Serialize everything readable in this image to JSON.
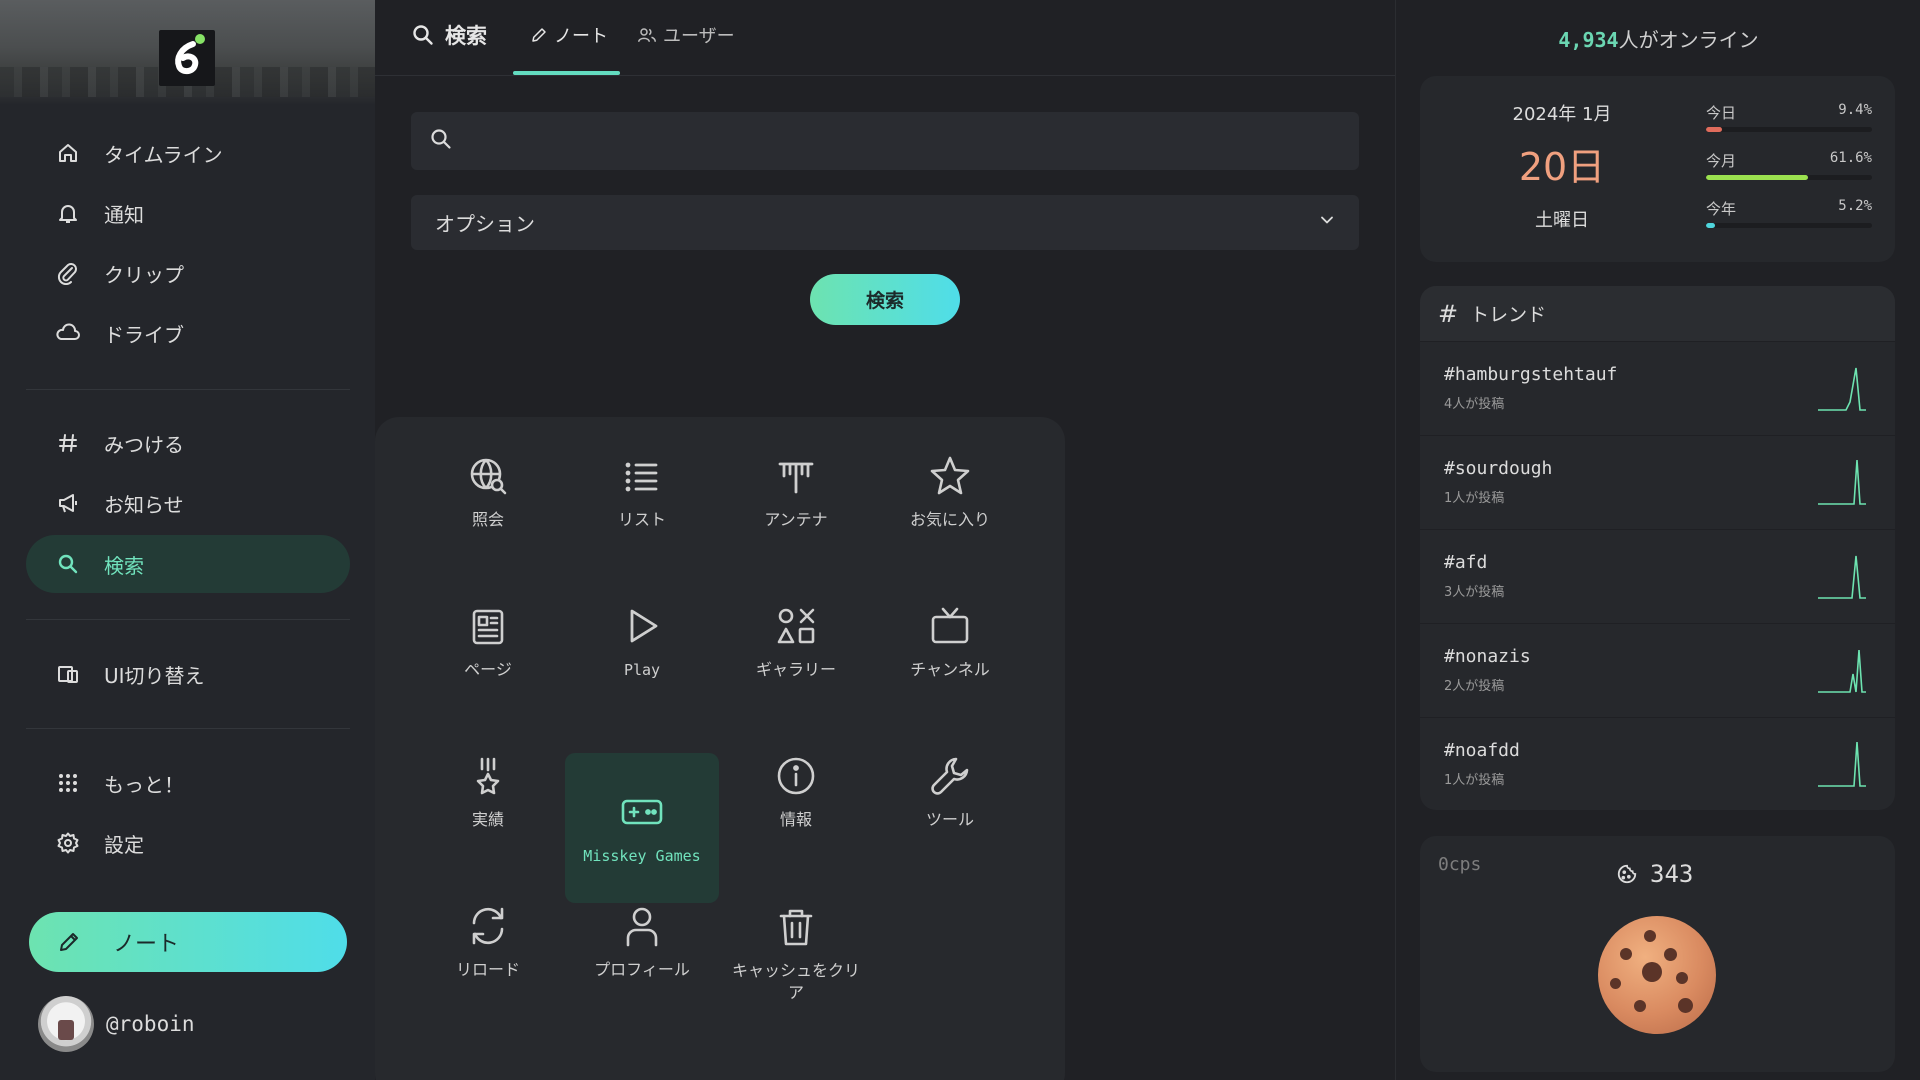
{
  "sidebar": {
    "items": [
      {
        "label": "タイムライン",
        "icon": "home-icon"
      },
      {
        "label": "通知",
        "icon": "bell-icon"
      },
      {
        "label": "クリップ",
        "icon": "paperclip-icon"
      },
      {
        "label": "ドライブ",
        "icon": "cloud-icon"
      },
      {
        "label": "みつける",
        "icon": "hash-icon"
      },
      {
        "label": "お知らせ",
        "icon": "megaphone-icon"
      },
      {
        "label": "検索",
        "icon": "search-icon",
        "active": true
      },
      {
        "label": "UI切り替え",
        "icon": "device-switch-icon"
      },
      {
        "label": "もっと！",
        "icon": "grid-dots-icon"
      },
      {
        "label": "設定",
        "icon": "gear-icon"
      }
    ],
    "post_label": "ノート",
    "account_name": "@roboin"
  },
  "main": {
    "title": "検索",
    "tabs": [
      {
        "label": "ノート",
        "icon": "pencil-icon",
        "active": true
      },
      {
        "label": "ユーザー",
        "icon": "users-icon",
        "active": false
      }
    ],
    "search_value": "",
    "options_label": "オプション",
    "search_button": "検索"
  },
  "menu": {
    "items": [
      {
        "label": "照会",
        "icon": "globe-search-icon"
      },
      {
        "label": "リスト",
        "icon": "list-icon"
      },
      {
        "label": "アンテナ",
        "icon": "antenna-icon"
      },
      {
        "label": "お気に入り",
        "icon": "star-icon"
      },
      {
        "label": "ページ",
        "icon": "news-icon"
      },
      {
        "label": "Play",
        "icon": "play-icon"
      },
      {
        "label": "ギャラリー",
        "icon": "shapes-icon"
      },
      {
        "label": "チャンネル",
        "icon": "tv-icon"
      },
      {
        "label": "実績",
        "icon": "medal-icon"
      },
      {
        "label": "Misskey Games",
        "icon": "gamepad-icon",
        "active": true
      },
      {
        "label": "情報",
        "icon": "info-icon"
      },
      {
        "label": "ツール",
        "icon": "wrench-icon"
      },
      {
        "label": "リロード",
        "icon": "reload-icon"
      },
      {
        "label": "プロフィール",
        "icon": "user-icon"
      },
      {
        "label": "キャッシュをクリア",
        "icon": "trash-icon"
      }
    ]
  },
  "right": {
    "online_count": "4,934",
    "online_suffix": "人がオンライン",
    "calendar": {
      "year_month": "2024年 1月",
      "day": "20日",
      "weekday": "土曜日",
      "bars": [
        {
          "label": "今日",
          "pct_text": "9.4%",
          "value": 9.4,
          "color": "#e06c5c"
        },
        {
          "label": "今月",
          "pct_text": "61.6%",
          "value": 61.6,
          "color": "#9be14f"
        },
        {
          "label": "今年",
          "pct_text": "5.2%",
          "value": 5.2,
          "color": "#4fd6dd"
        }
      ]
    },
    "trends": {
      "title": "トレンド",
      "items": [
        {
          "tag": "#hamburgstehtauf",
          "count": "4人が投稿"
        },
        {
          "tag": "#sourdough",
          "count": "1人が投稿"
        },
        {
          "tag": "#afd",
          "count": "3人が投稿"
        },
        {
          "tag": "#nonazis",
          "count": "2人が投稿"
        },
        {
          "tag": "#noafdd",
          "count": "1人が投稿"
        }
      ]
    },
    "clicker": {
      "cps": "0cps",
      "count": "343"
    }
  },
  "colors": {
    "accent": "#63dcc0",
    "accent_gradient_start": "#6de3b0",
    "accent_gradient_end": "#4fdde9",
    "active_bg": "#233b36"
  }
}
